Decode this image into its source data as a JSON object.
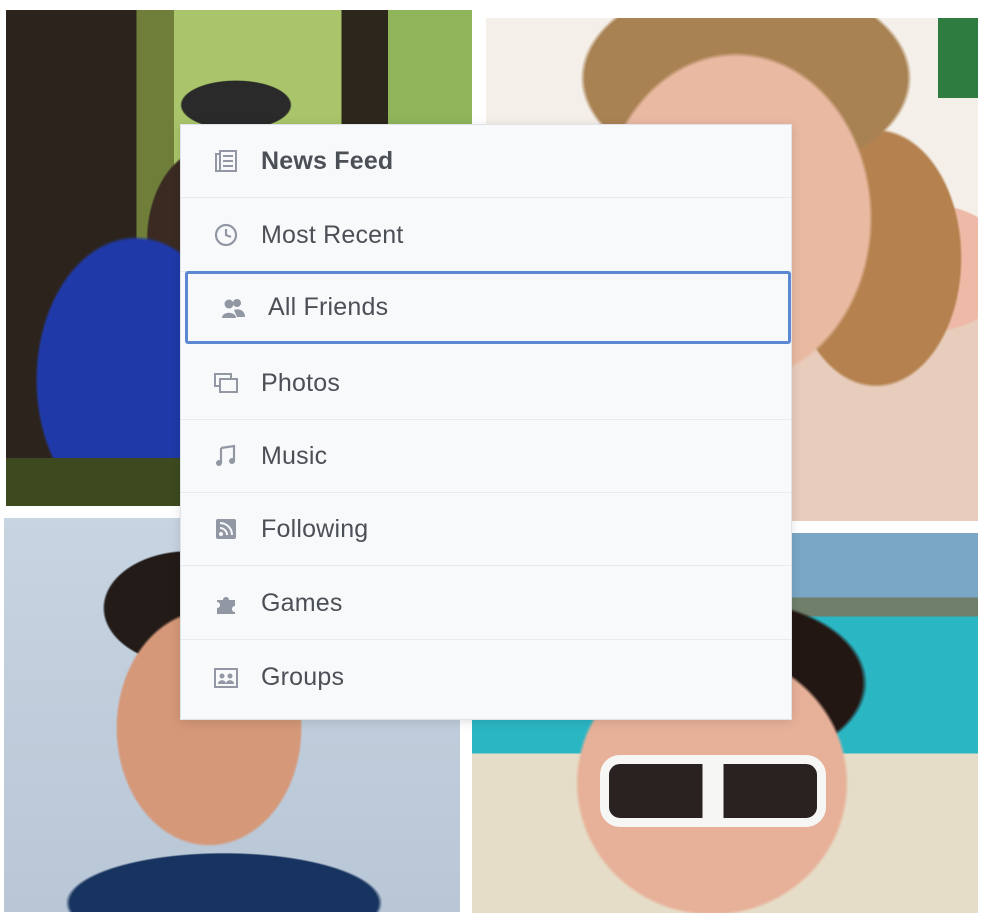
{
  "menu": {
    "items": [
      {
        "label": "News Feed",
        "icon": "news-feed-icon"
      },
      {
        "label": "Most Recent",
        "icon": "clock-icon"
      },
      {
        "label": "All Friends",
        "icon": "friends-icon"
      },
      {
        "label": "Photos",
        "icon": "photos-icon"
      },
      {
        "label": "Music",
        "icon": "music-note-icon"
      },
      {
        "label": "Following",
        "icon": "rss-feed-icon"
      },
      {
        "label": "Games",
        "icon": "puzzle-piece-icon"
      },
      {
        "label": "Groups",
        "icon": "groups-icon"
      }
    ],
    "selected": "All Friends",
    "accent_color": "#5b87d3"
  }
}
